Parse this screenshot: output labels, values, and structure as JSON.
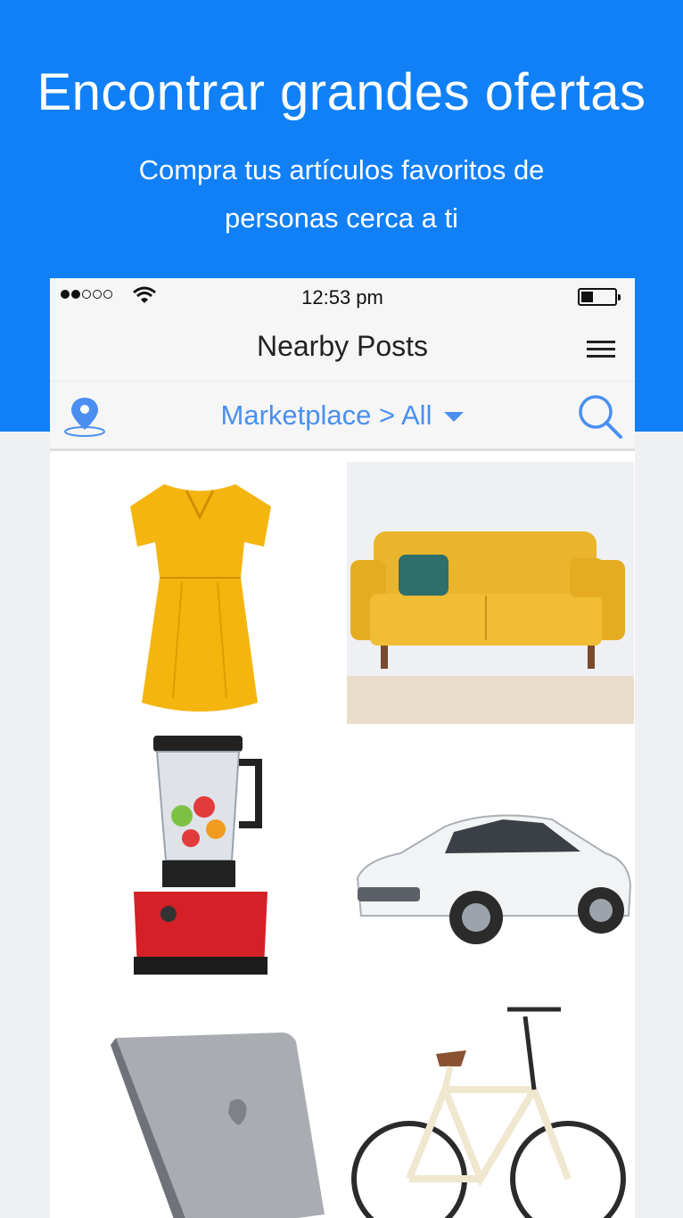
{
  "hero": {
    "title": "Encontrar grandes ofertas",
    "subtitle": "Compra tus artículos favoritos de personas cerca a ti"
  },
  "statusbar": {
    "time": "12:53 pm",
    "signal_icon": "signal-dots-icon",
    "wifi_icon": "wifi-icon",
    "battery_icon": "battery-icon"
  },
  "navbar": {
    "title": "Nearby Posts",
    "menu_icon": "hamburger-menu-icon"
  },
  "filter": {
    "breadcrumb": "Marketplace > All",
    "location_icon": "map-pin-icon",
    "search_icon": "search-icon"
  },
  "colors": {
    "brand_blue": "#1180f7",
    "link_blue": "#4a8ff0"
  },
  "items": [
    {
      "name": "yellow-dress"
    },
    {
      "name": "yellow-sofa"
    },
    {
      "name": "red-blender"
    },
    {
      "name": "white-sedan-car"
    },
    {
      "name": "silver-laptop"
    },
    {
      "name": "cream-bicycle"
    }
  ]
}
